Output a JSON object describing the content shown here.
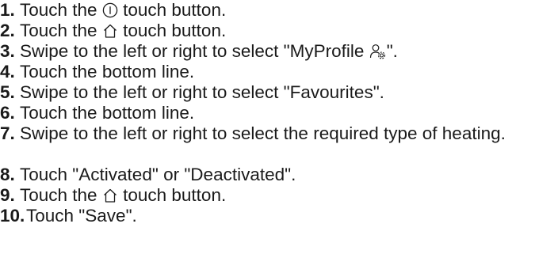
{
  "steps": [
    {
      "number": "1.",
      "before": "Touch the",
      "icon": "power-icon",
      "after": "touch button."
    },
    {
      "number": "2.",
      "before": "Touch the",
      "icon": "home-icon",
      "after": "touch button."
    },
    {
      "number": "3.",
      "before": "Swipe to the left or right to select \"MyProfile",
      "icon": "profile-settings-icon",
      "after": "\"."
    },
    {
      "number": "4.",
      "text": "Touch the bottom line."
    },
    {
      "number": "5.",
      "text": "Swipe to the left or right to select \"Favourites\"."
    },
    {
      "number": "6.",
      "text": "Touch the bottom line."
    },
    {
      "number": "7.",
      "text": "Swipe to the left or right to select the required type of heating."
    },
    {
      "number": "8.",
      "text": "Touch \"Activated\" or \"Deactivated\"."
    },
    {
      "number": "9.",
      "before": "Touch the",
      "icon": "home-icon",
      "after": "touch button."
    },
    {
      "number": "10.",
      "text": "Touch \"Save\"."
    }
  ]
}
